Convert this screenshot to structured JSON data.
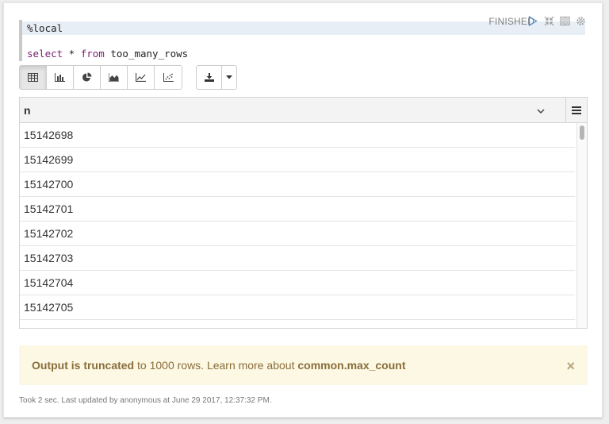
{
  "editor": {
    "line1": "%local",
    "line2_kw1": "select",
    "line2_op": " * ",
    "line2_kw2": "from",
    "line2_table": " too_many_rows"
  },
  "header": {
    "status": "FINISHED",
    "icons": [
      "run-icon",
      "collapse-icon",
      "book-icon",
      "gear-icon"
    ]
  },
  "toolbar": {
    "chart_buttons": [
      "table-icon",
      "bar-chart-icon",
      "pie-chart-icon",
      "area-chart-icon",
      "line-chart-icon",
      "scatter-chart-icon"
    ],
    "active": "table-icon",
    "download_buttons": [
      "download-icon",
      "caret-down-icon"
    ]
  },
  "table": {
    "column": "n",
    "rows": [
      "15142698",
      "15142699",
      "15142700",
      "15142701",
      "15142702",
      "15142703",
      "15142704",
      "15142705"
    ]
  },
  "notice": {
    "bold1": "Output is truncated",
    "mid": " to 1000 rows. Learn more about ",
    "bold2": "common.max_count",
    "close": "×"
  },
  "footer": {
    "text": "Took 2 sec. Last updated by anonymous at June 29 2017, 12:37:32 PM."
  },
  "colors": {
    "notice_bg": "#fcf8e3",
    "notice_text": "#8a6d3b",
    "keyword": "#7a1f6e"
  }
}
